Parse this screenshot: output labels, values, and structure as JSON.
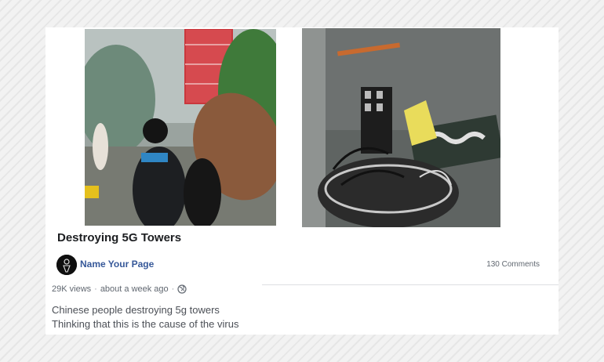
{
  "post": {
    "title": "Destroying 5G Towers",
    "page_name": "Name Your Page",
    "comments": "130 Comments",
    "views": "29K views",
    "time": "about a week ago",
    "separator": "·",
    "privacy_icon": "globe-icon",
    "description_lines": [
      "Chinese people destroying 5g towers",
      "Thinking that this is the cause of the virus"
    ]
  },
  "thumbnails": [
    {
      "name": "protest-video-still",
      "icon": "video-thumbnail"
    },
    {
      "name": "destroyed-equipment-still",
      "icon": "video-thumbnail"
    }
  ],
  "colors": {
    "link": "#365899",
    "title": "#1c1e21",
    "meta": "#606770"
  }
}
